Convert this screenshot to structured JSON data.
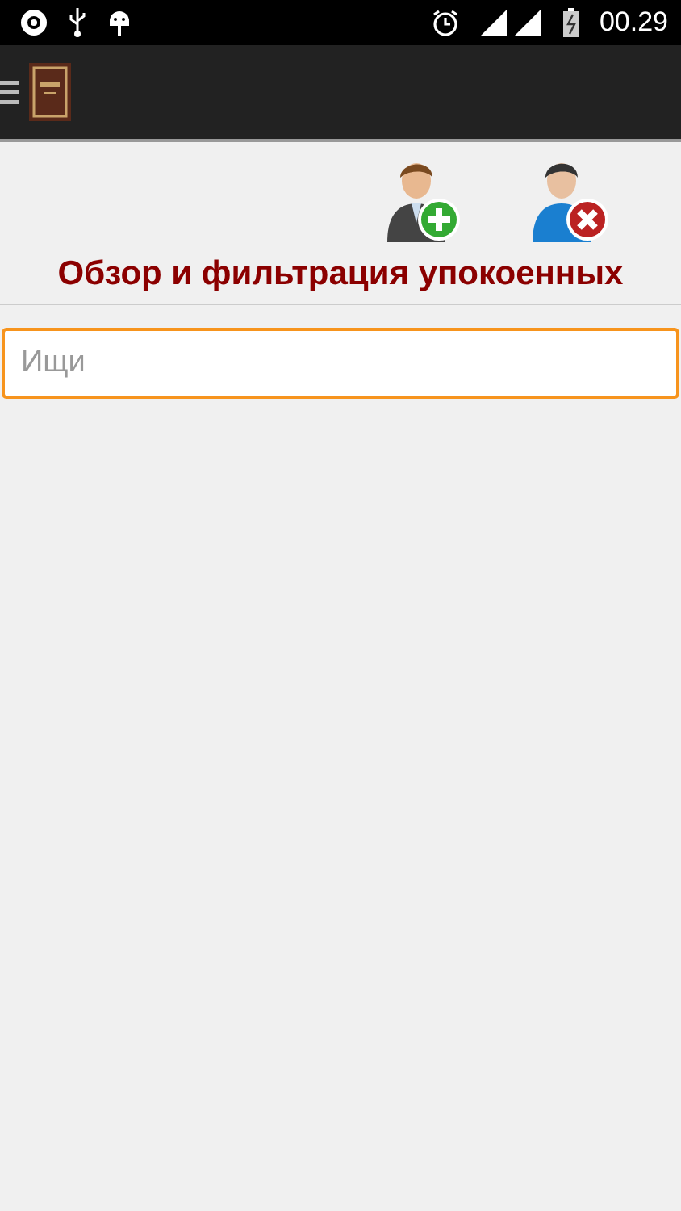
{
  "status_bar": {
    "time": "00.29"
  },
  "header": {
    "title": "Обзор и фильтрация упокоенных"
  },
  "search": {
    "placeholder": "Ищи",
    "focused": true
  }
}
